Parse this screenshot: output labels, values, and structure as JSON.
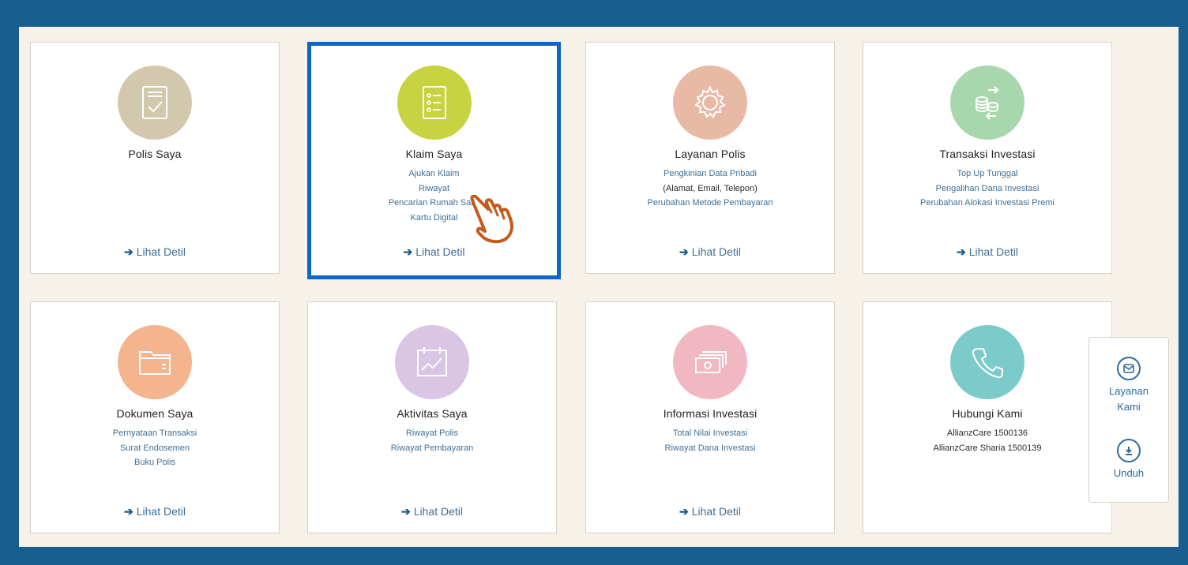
{
  "cards": [
    {
      "title": "Polis Saya",
      "icon": "document-check-icon",
      "color": "#d2c8ad",
      "links": [],
      "detail": "Lihat Detil"
    },
    {
      "title": "Klaim Saya",
      "icon": "checklist-icon",
      "color": "#c7d340",
      "links": [
        {
          "text": "Ajukan Klaim",
          "type": "link"
        },
        {
          "text": "Riwayat",
          "type": "link"
        },
        {
          "text": "Pencarian Rumah Sakit",
          "type": "link"
        },
        {
          "text": "Kartu Digital",
          "type": "link"
        }
      ],
      "detail": "Lihat Detil"
    },
    {
      "title": "Layanan Polis",
      "icon": "gear-icon",
      "color": "#e8baa6",
      "links": [
        {
          "text": "Pengkinian Data Pribadi",
          "type": "link"
        },
        {
          "text": "(Alamat, Email, Telepon)",
          "type": "plain"
        },
        {
          "text": "Perubahan Metode Pembayaran",
          "type": "link"
        }
      ],
      "detail": "Lihat Detil"
    },
    {
      "title": "Transaksi Investasi",
      "icon": "coins-transfer-icon",
      "color": "#a8d7ad",
      "links": [
        {
          "text": "Top Up Tunggal",
          "type": "link"
        },
        {
          "text": "Pengalihan Dana Investasi",
          "type": "link"
        },
        {
          "text": "Perubahan Alokasi Investasi Premi",
          "type": "link"
        }
      ],
      "detail": "Lihat Detil"
    },
    {
      "title": "Dokumen Saya",
      "icon": "folder-icon",
      "color": "#f3b48e",
      "links": [
        {
          "text": "Pernyataan Transaksi",
          "type": "link"
        },
        {
          "text": "Surat Endosemen",
          "type": "link"
        },
        {
          "text": "Buku Polis",
          "type": "link"
        }
      ],
      "detail": "Lihat Detil"
    },
    {
      "title": "Aktivitas Saya",
      "icon": "calendar-chart-icon",
      "color": "#d9c5e4",
      "links": [
        {
          "text": "Riwayat Polis",
          "type": "link"
        },
        {
          "text": "Riwayat Pembayaran",
          "type": "link"
        }
      ],
      "detail": "Lihat Detil"
    },
    {
      "title": "Informasi Investasi",
      "icon": "money-stack-icon",
      "color": "#f1b8c4",
      "links": [
        {
          "text": "Total Nilai Investasi",
          "type": "link"
        },
        {
          "text": "Riwayat Dana Investasi",
          "type": "link"
        }
      ],
      "detail": "Lihat Detil"
    },
    {
      "title": "Hubungi Kami",
      "icon": "phone-icon",
      "color": "#7ccbcb",
      "links": [
        {
          "text": "AllianzCare 1500136",
          "type": "plain"
        },
        {
          "text": "AllianzCare Sharia 1500139",
          "type": "plain"
        }
      ],
      "detail": ""
    }
  ],
  "float_panel": {
    "layanan_label": "Layanan Kami",
    "unduh_label": "Unduh"
  },
  "colors": {
    "frame": "#185f90",
    "panel_bg": "#f6f2e9",
    "active_border": "#0a68c4",
    "link": "#3f6f96",
    "hand_cursor": "#c45a1c"
  }
}
